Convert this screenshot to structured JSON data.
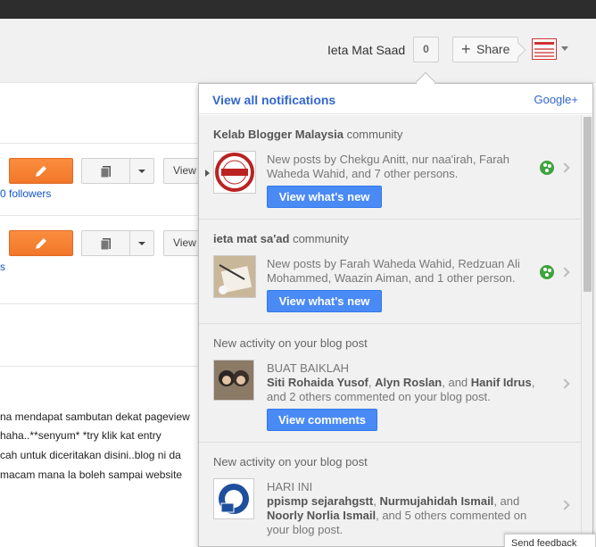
{
  "header": {
    "user_name": "Ieta Mat Saad",
    "notification_count": "0",
    "share_label": "Share"
  },
  "background": {
    "view_label": "View",
    "followers_text": "0 followers",
    "followers2_text": "s",
    "lines": [
      "na mendapat sambutan dekat pageview",
      "haha..**senyum* *try klik kat entry",
      "cah untuk diceritakan disini..blog ni da",
      "macam mana la boleh sampai website"
    ]
  },
  "panel": {
    "view_all": "View all notifications",
    "google_plus": "Google+",
    "items": [
      {
        "title_bold": "Kelab Blogger Malaysia",
        "title_rest": " community",
        "text": "New posts by Chekgu Anitt, nur naa'irah, Farah Waheda Wahid, and 7 other persons.",
        "button": "View what's new"
      },
      {
        "title_bold": "ieta mat sa'ad",
        "title_rest": " community",
        "text": "New posts by Farah Waheda Wahid, Redzuan Ali Mohammed, Waazin Aiman, and 1 other person.",
        "button": "View what's new"
      },
      {
        "title": "New activity on your blog post",
        "post": "BUAT BAIKLAH",
        "n1": "Siti Rohaida Yusof",
        "sep1": ", ",
        "n2": "Alyn Roslan",
        "sep2": ", and ",
        "n3": "Hanif Idrus",
        "tail": ",",
        "line3": "and 2 others commented on your blog post.",
        "button": "View comments"
      },
      {
        "title": "New activity on your blog post",
        "post": "HARI INI",
        "n1": "ppismp sejarahgstt",
        "sep1": ", ",
        "n2": "Nurmujahidah Ismail",
        "sep2": ", and",
        "n3": "Noorly Norlia Ismail",
        "tail": ", and 5 others commented on your blog post."
      }
    ]
  },
  "feedback_label": "Send feedback"
}
